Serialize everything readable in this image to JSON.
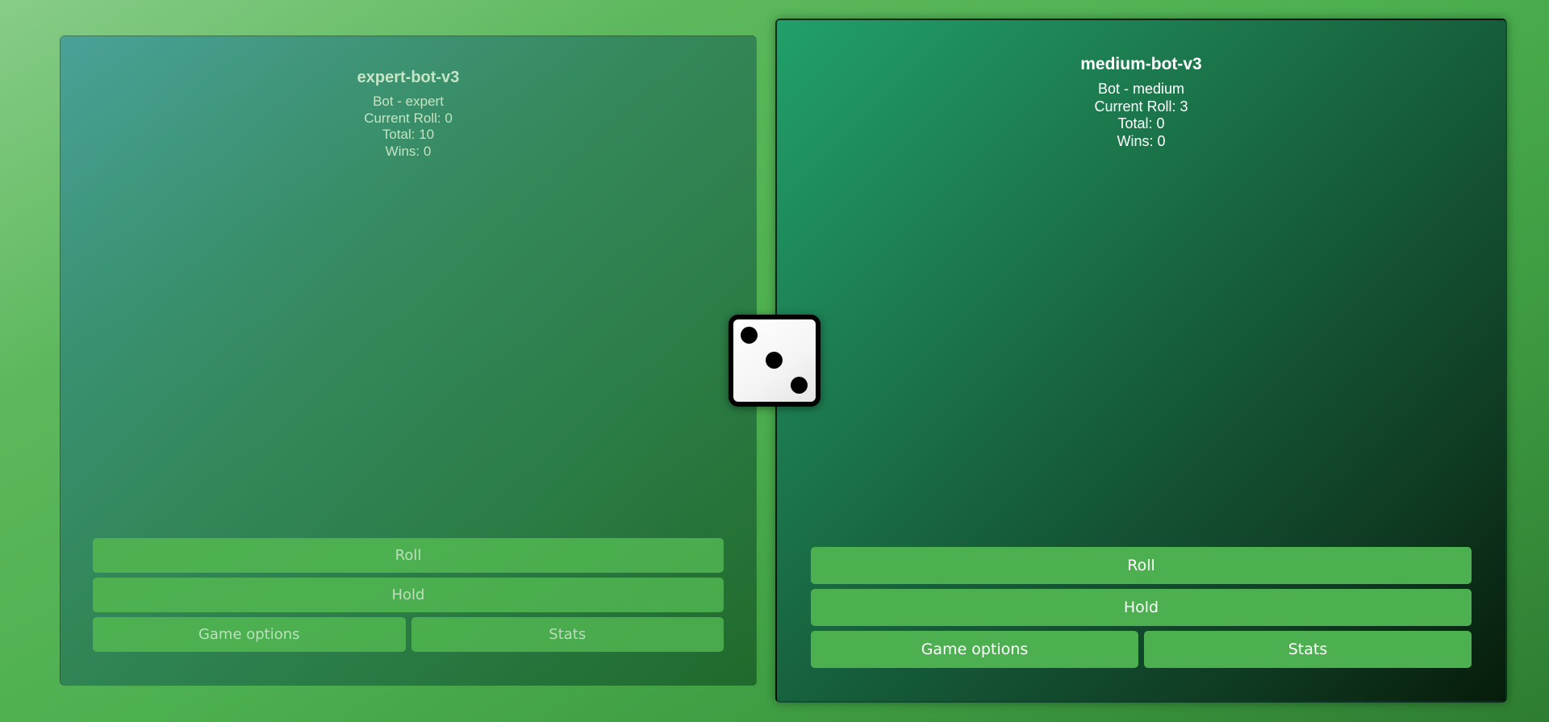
{
  "players": [
    {
      "name": "expert-bot-v3",
      "type_line": "Bot - expert",
      "current_roll": "Current Roll: 0",
      "total": "Total: 10",
      "wins": "Wins: 0",
      "active": false
    },
    {
      "name": "medium-bot-v3",
      "type_line": "Bot - medium",
      "current_roll": "Current Roll: 3",
      "total": "Total: 0",
      "wins": "Wins: 0",
      "active": true
    }
  ],
  "buttons": {
    "roll": "Roll",
    "hold": "Hold",
    "game_options": "Game options",
    "stats": "Stats"
  },
  "die": {
    "value": 3,
    "icon": "die-face-3-icon"
  },
  "colors": {
    "button_green": "#4caf50",
    "background_green": "#4caf50",
    "text_white": "#ffffff",
    "die_border": "#000000"
  }
}
